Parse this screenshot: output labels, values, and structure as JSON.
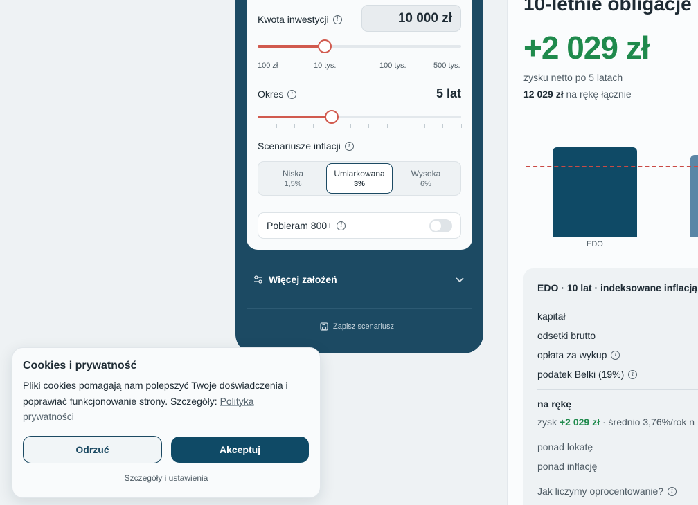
{
  "calculator": {
    "amount_label": "Kwota inwestycji",
    "amount_value": "10 000 zł",
    "amount_slider": {
      "value_fraction": 0.33
    },
    "amount_ticks": [
      "100 zł",
      "10 tys.",
      "100 tys.",
      "500 tys."
    ],
    "period_label": "Okres",
    "period_value": "5 lat",
    "period_slider": {
      "value_years": 5,
      "max_years": 12
    },
    "inflation_label": "Scenariusze inflacji",
    "inflation_options": [
      {
        "name": "Niska",
        "value": "1,5%",
        "selected": false
      },
      {
        "name": "Umiarkowana",
        "value": "3%",
        "selected": true
      },
      {
        "name": "Wysoka",
        "value": "6%",
        "selected": false
      }
    ],
    "toggle_label": "Pobieram 800+",
    "toggle_on": false
  },
  "more_assumptions": "Więcej założeń",
  "save_scenario": "Zapisz scenariusz",
  "results": {
    "title": "10-letnie obligacje",
    "gain": "+2 029 zł",
    "gain_caption": "zysku netto po 5 latach",
    "total_bold": "12 029 zł",
    "total_rest": "na rękę łącznie",
    "bar_label": "EDO",
    "colors": {
      "gain_green": "#1f8a4c",
      "inflation_line": "#c94a45",
      "bar": "#0f4a66"
    }
  },
  "detail": {
    "heading": "EDO · 10 lat · indeksowane inflacją",
    "rows": [
      "kapitał",
      "odsetki brutto",
      "opłata za wykup",
      "podatek Belki (19%)"
    ],
    "net_label": "na rękę",
    "gain_prefix": "zysk",
    "gain_value": "+2 029 zł",
    "gain_suffix": "· średnio 3,76%/rok n",
    "vs_deposit": "ponad lokatę",
    "vs_inflation": "ponad inflację",
    "how_calc": "Jak liczymy oprocentowanie?"
  },
  "cookies": {
    "title": "Cookies i prywatność",
    "text": "Pliki cookies pomagają nam polepszyć Twoje doświadczenia i poprawiać funkcjonowanie strony. Szczegóły:",
    "policy_link": "Polityka prywatności",
    "reject": "Odrzuć",
    "accept": "Akceptuj",
    "details": "Szczegóły i ustawienia"
  }
}
